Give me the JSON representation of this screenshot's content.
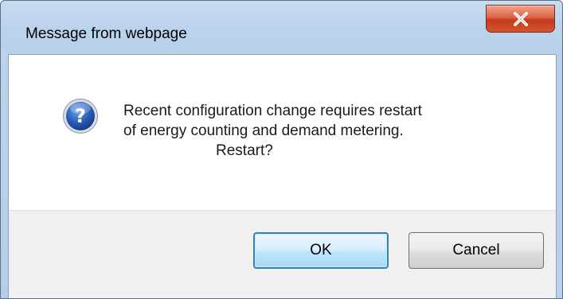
{
  "window": {
    "title": "Message from webpage",
    "close_icon": "close-x-icon"
  },
  "dialog": {
    "icon": "question-icon",
    "icon_glyph": "?",
    "message_lines": [
      "Recent configuration change requires restart",
      "of energy counting and demand metering.",
      "Restart?"
    ]
  },
  "buttons": {
    "ok_label": "OK",
    "cancel_label": "Cancel"
  },
  "colors": {
    "title_bar": "#bcd3ec",
    "close_button": "#d45531",
    "question_icon": "#2a5db8",
    "ok_border": "#3c7fb1",
    "footer": "#f0f0f0"
  }
}
